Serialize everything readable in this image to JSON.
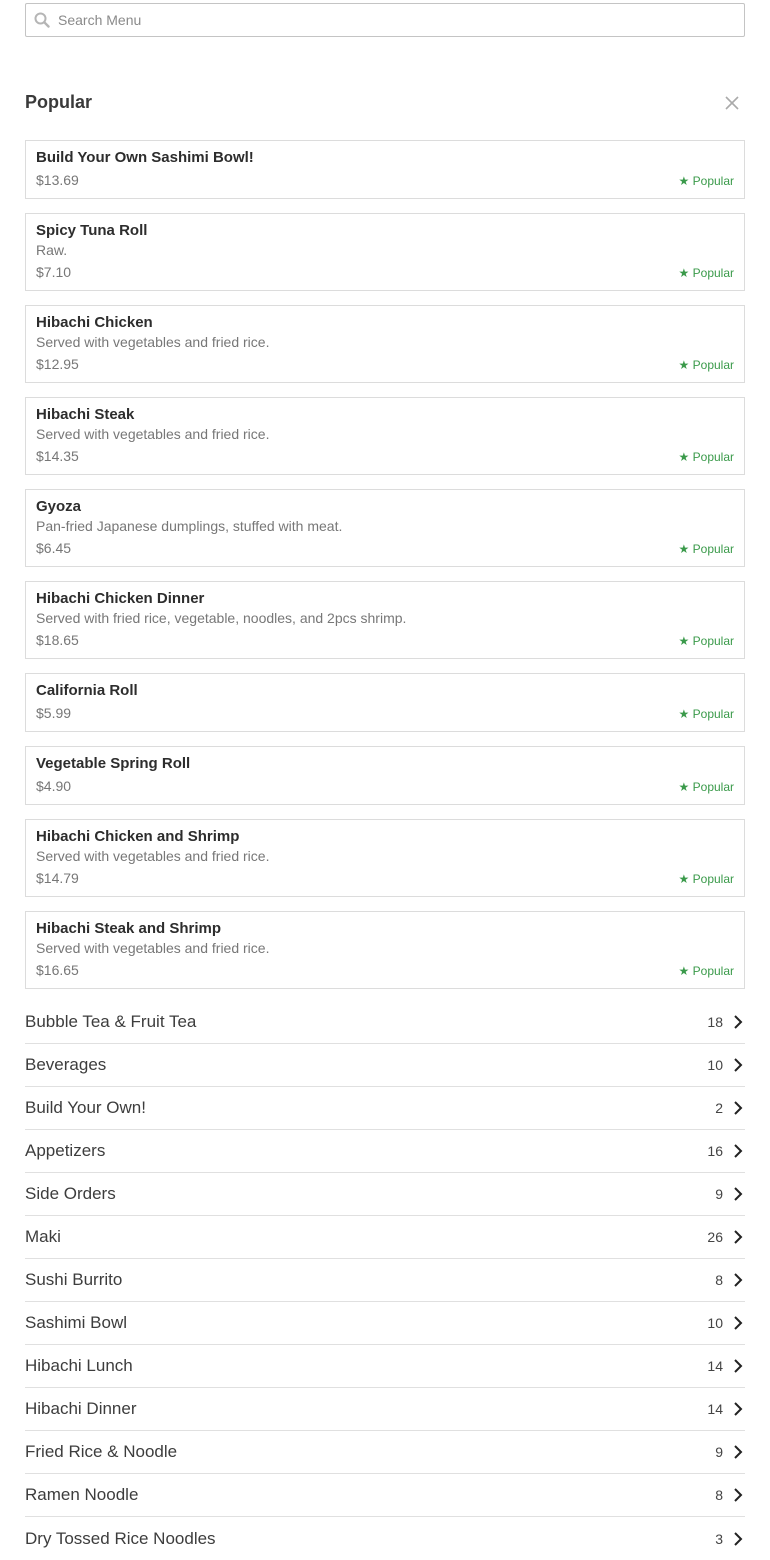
{
  "search": {
    "placeholder": "Search Menu",
    "icon": "search-icon"
  },
  "popular_section": {
    "title": "Popular",
    "close_icon": "close-icon",
    "badge_label": "★ Popular",
    "badge_color": "#3a9a4a",
    "items": [
      {
        "name": "Build Your Own Sashimi Bowl!",
        "description": "",
        "price": "$13.69"
      },
      {
        "name": "Spicy Tuna Roll",
        "description": "Raw.",
        "price": "$7.10"
      },
      {
        "name": "Hibachi Chicken",
        "description": "Served with vegetables and fried rice.",
        "price": "$12.95"
      },
      {
        "name": "Hibachi Steak",
        "description": "Served with vegetables and fried rice.",
        "price": "$14.35"
      },
      {
        "name": "Gyoza",
        "description": "Pan-fried Japanese dumplings, stuffed with meat.",
        "price": "$6.45"
      },
      {
        "name": "Hibachi Chicken Dinner",
        "description": "Served with fried rice, vegetable, noodles, and 2pcs shrimp.",
        "price": "$18.65"
      },
      {
        "name": "California Roll",
        "description": "",
        "price": "$5.99"
      },
      {
        "name": "Vegetable Spring Roll",
        "description": "",
        "price": "$4.90"
      },
      {
        "name": "Hibachi Chicken and Shrimp",
        "description": "Served with vegetables and fried rice.",
        "price": "$14.79"
      },
      {
        "name": "Hibachi Steak and Shrimp",
        "description": "Served with vegetables and fried rice.",
        "price": "$16.65"
      }
    ]
  },
  "categories": [
    {
      "name": "Bubble Tea & Fruit Tea",
      "count": "18"
    },
    {
      "name": "Beverages",
      "count": "10"
    },
    {
      "name": "Build Your Own!",
      "count": "2"
    },
    {
      "name": "Appetizers",
      "count": "16"
    },
    {
      "name": "Side Orders",
      "count": "9"
    },
    {
      "name": "Maki",
      "count": "26"
    },
    {
      "name": "Sushi Burrito",
      "count": "8"
    },
    {
      "name": "Sashimi Bowl",
      "count": "10"
    },
    {
      "name": "Hibachi Lunch",
      "count": "14"
    },
    {
      "name": "Hibachi Dinner",
      "count": "14"
    },
    {
      "name": "Fried Rice & Noodle",
      "count": "9"
    },
    {
      "name": "Ramen Noodle",
      "count": "8"
    },
    {
      "name": "Dry Tossed Rice Noodles",
      "count": "3"
    }
  ],
  "category_chevron_icon": "chevron-right-icon"
}
